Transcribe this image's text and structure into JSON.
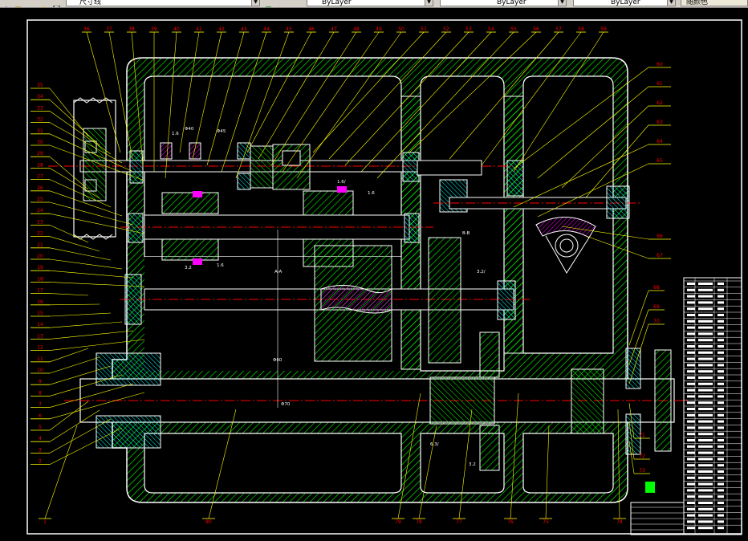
{
  "toolbar": {
    "linetype_label": "尺寸线",
    "layer_value": "ByLayer",
    "linetype_value": "ByLayer",
    "lineweight_value": "ByLayer",
    "plotstyle_value": "随颜色"
  },
  "colors": {
    "background": "#000000",
    "outline": "#ffffff",
    "hatch": "#00ff00",
    "leader": "#ffff00",
    "number": "#ff0000",
    "centerline": "#ff0000",
    "dimension": "#ffffff",
    "gear": "#ff00ff",
    "bearing": "#00ffff"
  },
  "drawing": {
    "top_callouts": [
      "36",
      "37",
      "38",
      "39",
      "40",
      "41",
      "42",
      "43",
      "44",
      "45",
      "46",
      "47",
      "48",
      "49",
      "50",
      "51",
      "52",
      "53",
      "54",
      "55",
      "56",
      "57",
      "58",
      "59"
    ],
    "right_callouts": [
      "60",
      "61",
      "62",
      "63",
      "64",
      "65",
      "66",
      "67"
    ],
    "left_callouts": [
      "35",
      "34",
      "33",
      "32",
      "31",
      "30",
      "29",
      "28",
      "27",
      "26",
      "25",
      "24",
      "23",
      "22",
      "21",
      "20",
      "19",
      "18",
      "17",
      "16",
      "15",
      "14",
      "13",
      "12",
      "11",
      "10",
      "9",
      "8",
      "7",
      "6",
      "5",
      "4",
      "3",
      "2"
    ],
    "bottom_callouts": [
      "1",
      "80",
      "79",
      "78",
      "77",
      "76",
      "75",
      "74"
    ],
    "right_lower_callouts": [
      "68",
      "69",
      "70",
      "71",
      "72",
      "73"
    ],
    "dimension_labels": [
      "1.6",
      "Φ40",
      "Φ45",
      "1.6/",
      "1.6",
      "3.2",
      "1.6",
      "A-A",
      "B-B",
      "3.2/",
      "6.3/",
      "3.2",
      "Φ60",
      "Φ70"
    ]
  }
}
